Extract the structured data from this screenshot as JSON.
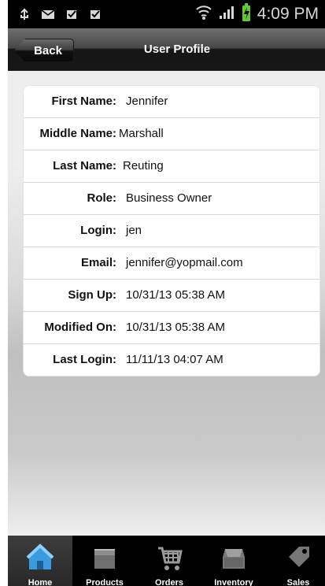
{
  "status_bar": {
    "time": "4:09 PM",
    "icons": [
      "usb-icon",
      "mail-icon",
      "download-icon",
      "download-icon",
      "wifi-icon",
      "signal-icon",
      "battery-charging-icon"
    ]
  },
  "header": {
    "back_label": "Back",
    "title": "User Profile"
  },
  "profile": {
    "rows": [
      {
        "label": "First Name:",
        "value": "Jennifer"
      },
      {
        "label": "Middle Name:",
        "value": "Marshall"
      },
      {
        "label": "Last Name:",
        "value": "Reuting"
      },
      {
        "label": "Role:",
        "value": "Business Owner"
      },
      {
        "label": "Login:",
        "value": "jen"
      },
      {
        "label": "Email:",
        "value": "jennifer@yopmail.com"
      },
      {
        "label": "Sign Up:",
        "value": "10/31/13 05:38 AM"
      },
      {
        "label": "Modified On:",
        "value": "10/31/13 05:38 AM"
      },
      {
        "label": "Last Login:",
        "value": "11/11/13 04:07 AM"
      }
    ]
  },
  "tabs": [
    {
      "label": "Home",
      "icon": "home-icon",
      "active": true
    },
    {
      "label": "Products",
      "icon": "products-box-icon",
      "active": false
    },
    {
      "label": "Orders",
      "icon": "shopping-cart-icon",
      "active": false
    },
    {
      "label": "Inventory",
      "icon": "inventory-drawer-icon",
      "active": false
    },
    {
      "label": "Sales",
      "icon": "sales-tag-icon",
      "active": false
    }
  ],
  "colors": {
    "status_bar": "#000000",
    "header_top": "#6f6f6f",
    "header_bottom": "#171717",
    "active_tab": "#3d3d3d",
    "home_icon": "#3a9be0",
    "battery": "#62c63d"
  }
}
